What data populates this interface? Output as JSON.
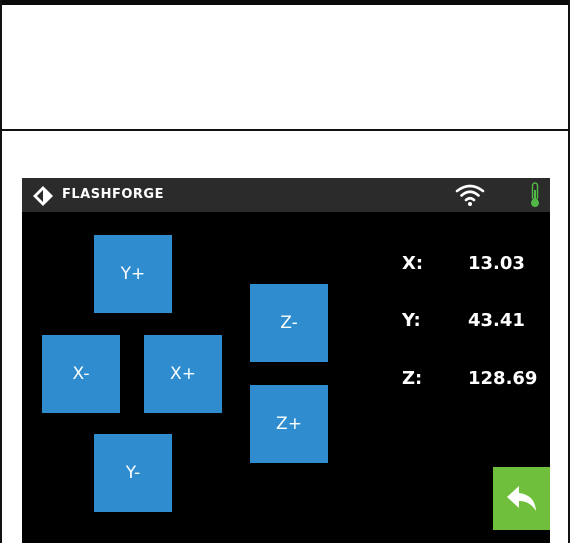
{
  "header": {
    "brand": "FLASHFORGE",
    "icons": {
      "logo": "flashforge-logo-icon",
      "wifi": "wifi-icon",
      "temperature": "thermometer-icon"
    }
  },
  "jog": {
    "y_plus": "Y+",
    "x_minus": "X-",
    "x_plus": "X+",
    "y_minus": "Y-",
    "z_minus": "Z-",
    "z_plus": "Z+"
  },
  "position": {
    "x_label": "X:",
    "x_value": "13.03",
    "y_label": "Y:",
    "y_value": "43.41",
    "z_label": "Z:",
    "z_value": "128.69"
  },
  "back": {
    "icon": "back-arrow-icon"
  },
  "colors": {
    "button_blue": "#2e8ccf",
    "back_green": "#6fbf3c",
    "status_bar": "#2b2b2b",
    "screen_bg": "#000000",
    "thermometer_green": "#52b848"
  }
}
